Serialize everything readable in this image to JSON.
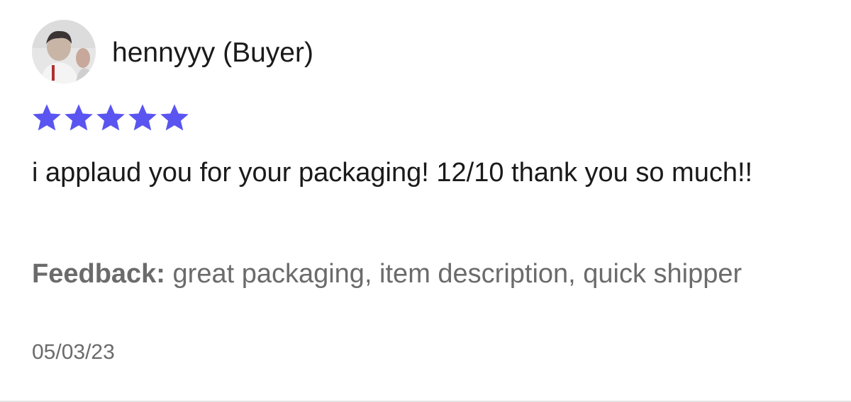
{
  "review": {
    "reviewer_name": "hennyyy (Buyer)",
    "rating": 5,
    "max_rating": 5,
    "star_color": "#5a55f0",
    "text": "i applaud you for your packaging! 12/10 thank you so much!!",
    "feedback_label": "Feedback:",
    "feedback_tags": " great packaging, item description, quick shipper",
    "date": "05/03/23"
  }
}
